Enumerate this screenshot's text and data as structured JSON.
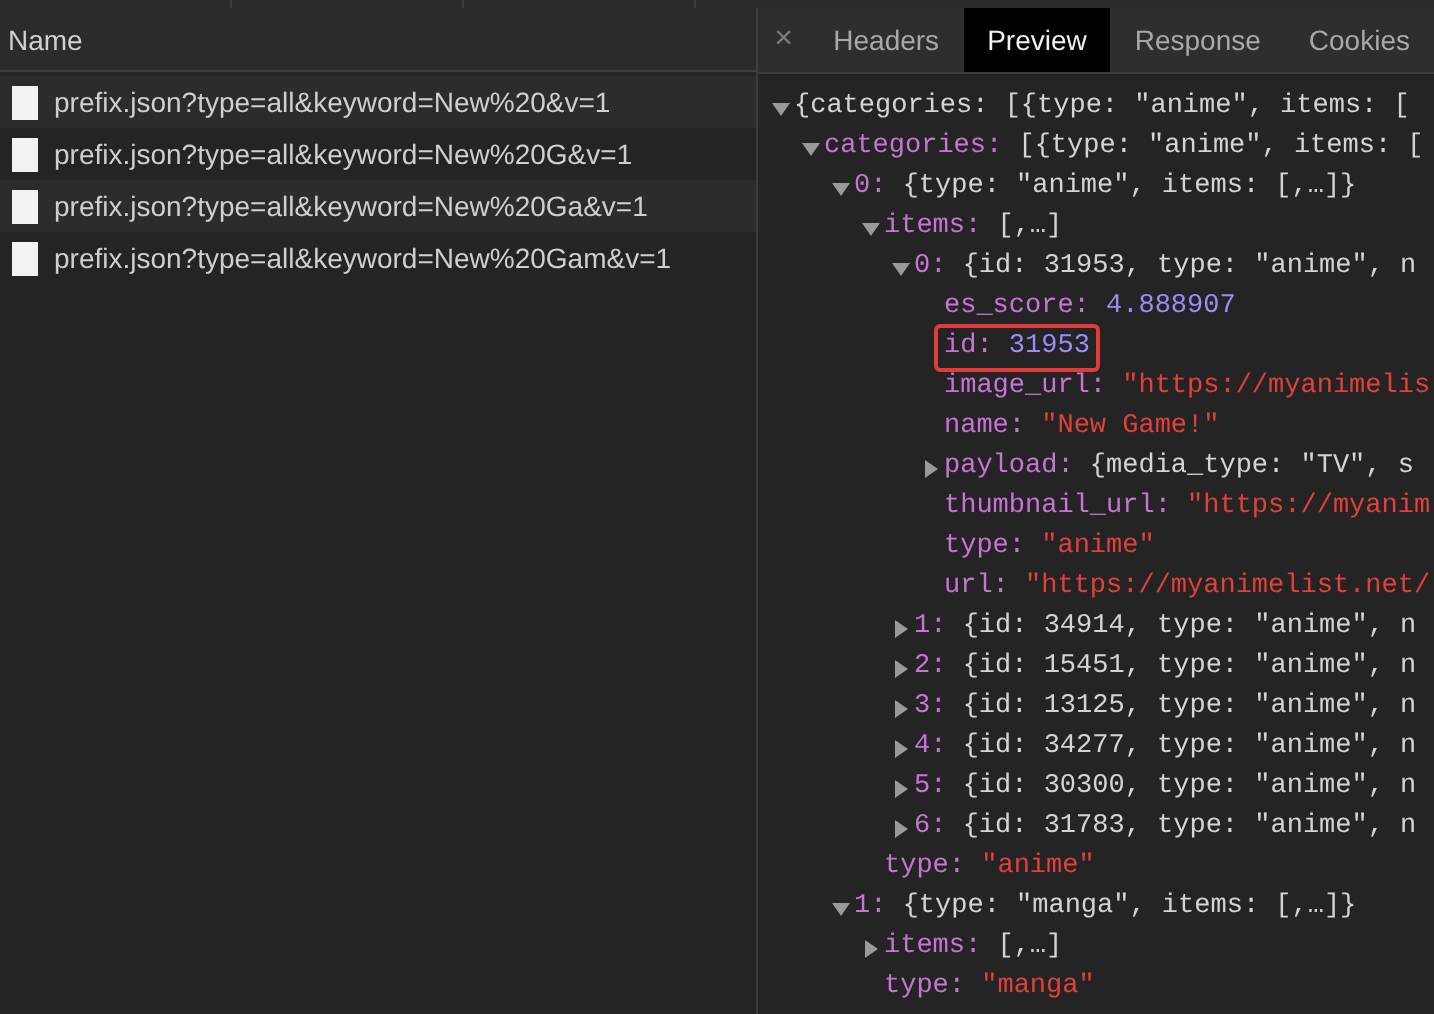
{
  "requests": {
    "header": "Name",
    "rows": [
      {
        "name": "prefix.json?type=all&keyword=New%20&v=1"
      },
      {
        "name": "prefix.json?type=all&keyword=New%20G&v=1"
      },
      {
        "name": "prefix.json?type=all&keyword=New%20Ga&v=1"
      },
      {
        "name": "prefix.json?type=all&keyword=New%20Gam&v=1"
      }
    ]
  },
  "detail": {
    "close": "×",
    "tabs": [
      {
        "label": "Headers",
        "selected": false
      },
      {
        "label": "Preview",
        "selected": true
      },
      {
        "label": "Response",
        "selected": false
      },
      {
        "label": "Cookies",
        "selected": false
      }
    ],
    "tree": [
      {
        "kind": "object",
        "expanded": true,
        "highlighted": false,
        "summary": "{categories: [{type: \"anime\", items: [",
        "children": [
          {
            "kind": "object",
            "key": "categories:",
            "expanded": true,
            "highlighted": false,
            "summary": "[{type: \"anime\", items: [",
            "children": [
              {
                "kind": "object",
                "key": "0:",
                "expanded": true,
                "highlighted": false,
                "summary": "{type: \"anime\", items: [,…]}",
                "children": [
                  {
                    "kind": "object",
                    "key": "items:",
                    "expanded": true,
                    "highlighted": false,
                    "summary": "[,…]",
                    "children": [
                      {
                        "kind": "object",
                        "key": "0:",
                        "expanded": true,
                        "highlighted": false,
                        "summary": "{id: 31953, type: \"anime\", n",
                        "children": [
                          {
                            "kind": "number",
                            "key": "es_score:",
                            "value": "4.888907",
                            "highlighted": false
                          },
                          {
                            "kind": "number",
                            "key": "id:",
                            "value": "31953",
                            "highlighted": true
                          },
                          {
                            "kind": "string",
                            "key": "image_url:",
                            "value": "\"https://myanimelis",
                            "highlighted": false
                          },
                          {
                            "kind": "string",
                            "key": "name:",
                            "value": "\"New Game!\"",
                            "highlighted": false
                          },
                          {
                            "kind": "object",
                            "key": "payload:",
                            "expanded": false,
                            "highlighted": false,
                            "summary": "{media_type: \"TV\", s"
                          },
                          {
                            "kind": "string",
                            "key": "thumbnail_url:",
                            "value": "\"https://myanim",
                            "highlighted": false
                          },
                          {
                            "kind": "string",
                            "key": "type:",
                            "value": "\"anime\"",
                            "highlighted": false
                          },
                          {
                            "kind": "string",
                            "key": "url:",
                            "value": "\"https://myanimelist.net/",
                            "highlighted": false
                          }
                        ]
                      },
                      {
                        "kind": "object",
                        "key": "1:",
                        "expanded": false,
                        "highlighted": false,
                        "summary": "{id: 34914, type: \"anime\", n"
                      },
                      {
                        "kind": "object",
                        "key": "2:",
                        "expanded": false,
                        "highlighted": false,
                        "summary": "{id: 15451, type: \"anime\", n"
                      },
                      {
                        "kind": "object",
                        "key": "3:",
                        "expanded": false,
                        "highlighted": false,
                        "summary": "{id: 13125, type: \"anime\", n"
                      },
                      {
                        "kind": "object",
                        "key": "4:",
                        "expanded": false,
                        "highlighted": false,
                        "summary": "{id: 34277, type: \"anime\", n"
                      },
                      {
                        "kind": "object",
                        "key": "5:",
                        "expanded": false,
                        "highlighted": false,
                        "summary": "{id: 30300, type: \"anime\", n"
                      },
                      {
                        "kind": "object",
                        "key": "6:",
                        "expanded": false,
                        "highlighted": false,
                        "summary": "{id: 31783, type: \"anime\", n"
                      }
                    ]
                  },
                  {
                    "kind": "string",
                    "key": "type:",
                    "value": "\"anime\"",
                    "highlighted": false
                  }
                ]
              },
              {
                "kind": "object",
                "key": "1:",
                "expanded": true,
                "highlighted": false,
                "summary": "{type: \"manga\", items: [,…]}",
                "children": [
                  {
                    "kind": "object",
                    "key": "items:",
                    "expanded": false,
                    "highlighted": false,
                    "summary": "[,…]"
                  },
                  {
                    "kind": "string",
                    "key": "type:",
                    "value": "\"manga\"",
                    "highlighted": false
                  }
                ]
              }
            ]
          }
        ]
      }
    ]
  }
}
